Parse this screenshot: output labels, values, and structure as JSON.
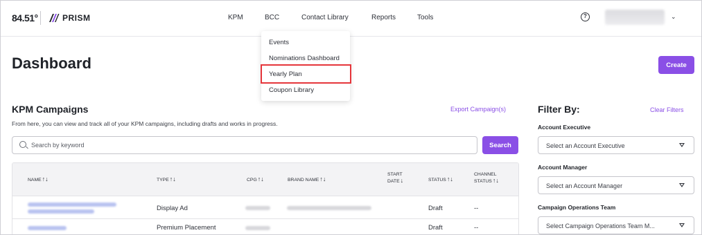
{
  "brand": {
    "logo_84": "84.51°",
    "product": "PRISM"
  },
  "nav": {
    "items": [
      "KPM",
      "BCC",
      "Contact Library",
      "Reports",
      "Tools"
    ],
    "help_symbol": "?",
    "user_chevron": "⌄"
  },
  "bcc_menu": {
    "items": [
      "Events",
      "Nominations Dashboard",
      "Yearly Plan",
      "Coupon Library"
    ],
    "highlighted": "Yearly Plan",
    "highlight_color": "#e5353a"
  },
  "page": {
    "title": "Dashboard",
    "create_label": "Create"
  },
  "campaigns": {
    "title": "KPM Campaigns",
    "description": "From here, you can view and track all of your KPM campaigns, including drafts and works in progress.",
    "export_label": "Export Campaign(s)",
    "search_placeholder": "Search by keyword",
    "search_label": "Search",
    "columns": [
      "NAME",
      "TYPE",
      "CPG",
      "BRAND NAME",
      "START DATE",
      "STATUS",
      "CHANNEL STATUS"
    ],
    "rows": [
      {
        "type": "Display Ad",
        "status": "Draft",
        "channel_status": "--"
      },
      {
        "type": "Premium Placement",
        "status": "Draft",
        "channel_status": "--"
      }
    ]
  },
  "filters": {
    "title": "Filter By:",
    "clear_label": "Clear Filters",
    "groups": [
      {
        "label": "Account Executive",
        "placeholder": "Select an Account Executive"
      },
      {
        "label": "Account Manager",
        "placeholder": "Select an Account Manager"
      },
      {
        "label": "Campaign Operations Team",
        "placeholder": "Select Campaign Operations Team M..."
      }
    ]
  },
  "colors": {
    "accent": "#8a4fe6",
    "text": "#1f2228",
    "border": "#c5c5cb"
  },
  "icons": [
    "prism-logo-icon",
    "help-circle-icon",
    "chevron-down-icon",
    "search-icon",
    "sort-icon"
  ]
}
